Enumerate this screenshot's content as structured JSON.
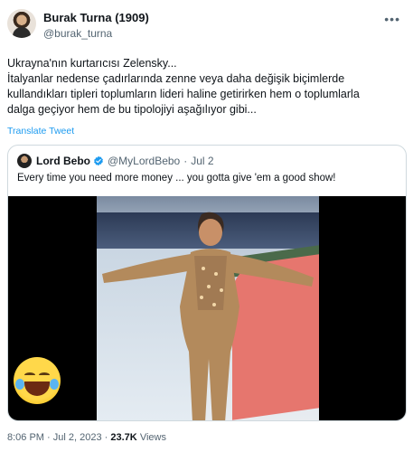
{
  "author": {
    "display_name": "Burak Turna (1909)",
    "handle": "@burak_turna"
  },
  "tweet": {
    "lines": [
      "Ukrayna'nın kurtarıcısı Zelensky...",
      "İtalyanlar nedense çadırlarında zenne veya daha değişik biçimlerde",
      "kullandıkları tipleri toplumların lideri haline getirirken hem o toplumlarla",
      "dalga geçiyor hem de bu tipolojiyi aşağılıyor gibi..."
    ],
    "translate_label": "Translate Tweet"
  },
  "quote": {
    "name": "Lord Bebo",
    "handle": "@MyLordBebo",
    "separator": "·",
    "date": "Jul 2",
    "text": "Every time you need more money ... you gotta give 'em a good show!",
    "verified_color": "#1d9bf0"
  },
  "meta": {
    "time": "8:06 PM",
    "separator": "·",
    "date": "Jul 2, 2023",
    "views_count": "23.7K",
    "views_label": "Views"
  },
  "icons": {
    "more": "more-icon",
    "verified": "verified-icon",
    "emoji": "face-with-tears-of-joy-icon"
  }
}
